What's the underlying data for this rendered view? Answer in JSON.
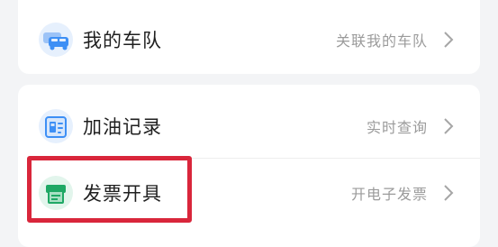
{
  "menu": {
    "fleet": {
      "title": "我的车队",
      "hint": "关联我的车队",
      "icon": "fleet-car-icon"
    },
    "fuel": {
      "title": "加油记录",
      "hint": "实时查询",
      "icon": "fuel-record-icon"
    },
    "invoice": {
      "title": "发票开具",
      "hint": "开电子发票",
      "icon": "invoice-printer-icon"
    }
  },
  "colors": {
    "background": "#f3f4f6",
    "card": "#ffffff",
    "title": "#1f1f1f",
    "hint": "#9b9b9b",
    "highlight": "#d9263b",
    "iconBlue": "#3d8ff5",
    "iconGreen": "#1fa865"
  }
}
